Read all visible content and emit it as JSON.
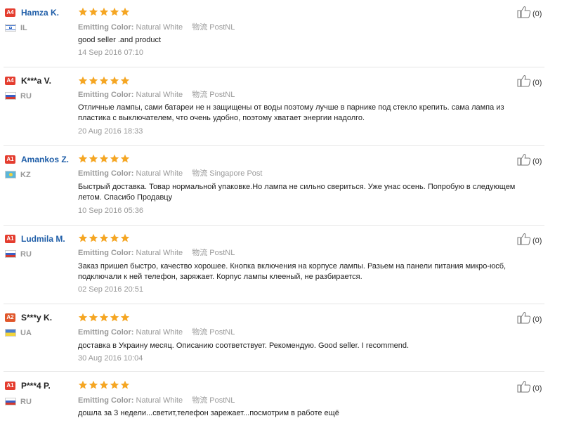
{
  "labels": {
    "emitting_color": "Emitting Color:",
    "shipping_label": "物流"
  },
  "reviews": [
    {
      "level": "A4",
      "name": "Hamza K.",
      "country": "IL",
      "color": "Natural White",
      "shipping": "PostNL",
      "text": "good seller .and product",
      "date": "14 Sep 2016 07:10",
      "helpful": "(0)",
      "rating": 5
    },
    {
      "level": "A4",
      "name": "K***a V.",
      "country": "RU",
      "color": "Natural White",
      "shipping": "PostNL",
      "text": "Отличные лампы, сами батареи не н защищены от воды поэтому лучше в парнике под стекло крепить. сама лампа из пластика с выключателем, что очень удобно, поэтому хватает энергии надолго.",
      "date": "20 Aug 2016 18:33",
      "helpful": "(0)",
      "rating": 5
    },
    {
      "level": "A1",
      "name": "Amankos Z.",
      "country": "KZ",
      "color": "Natural White",
      "shipping": "Singapore Post",
      "text": "Быстрый доставка. Товар нормальной упаковке.Но лампа не сильно свериться. Уже унас осень. Попробую в следующем летом. Спасибо Продавцу",
      "date": "10 Sep 2016 05:36",
      "helpful": "(0)",
      "rating": 5
    },
    {
      "level": "A1",
      "name": "Ludmila M.",
      "country": "RU",
      "color": "Natural White",
      "shipping": "PostNL",
      "text": "Заказ пришел быстро, качество хорошее. Кнопка включения на корпусе лампы. Разьем на панели питания микро-юсб, подключали к ней телефон, заряжает. Корпус лампы клееный, не разбирается.",
      "date": "02 Sep 2016 20:51",
      "helpful": "(0)",
      "rating": 5
    },
    {
      "level": "A2",
      "name": "S***y K.",
      "country": "UA",
      "color": "Natural White",
      "shipping": "PostNL",
      "text": "доставка в Украину месяц. Описанию соответствует. Рекомендую. Good seller. I recommend.",
      "date": "30 Aug 2016 10:04",
      "helpful": "(0)",
      "rating": 5
    },
    {
      "level": "A1",
      "name": "P***4 P.",
      "country": "RU",
      "color": "Natural White",
      "shipping": "PostNL",
      "text": "дошла за 3 недели...светит,телефон зарежает...посмотрим в работе ещё",
      "date": "",
      "helpful": "(0)",
      "rating": 5
    }
  ]
}
